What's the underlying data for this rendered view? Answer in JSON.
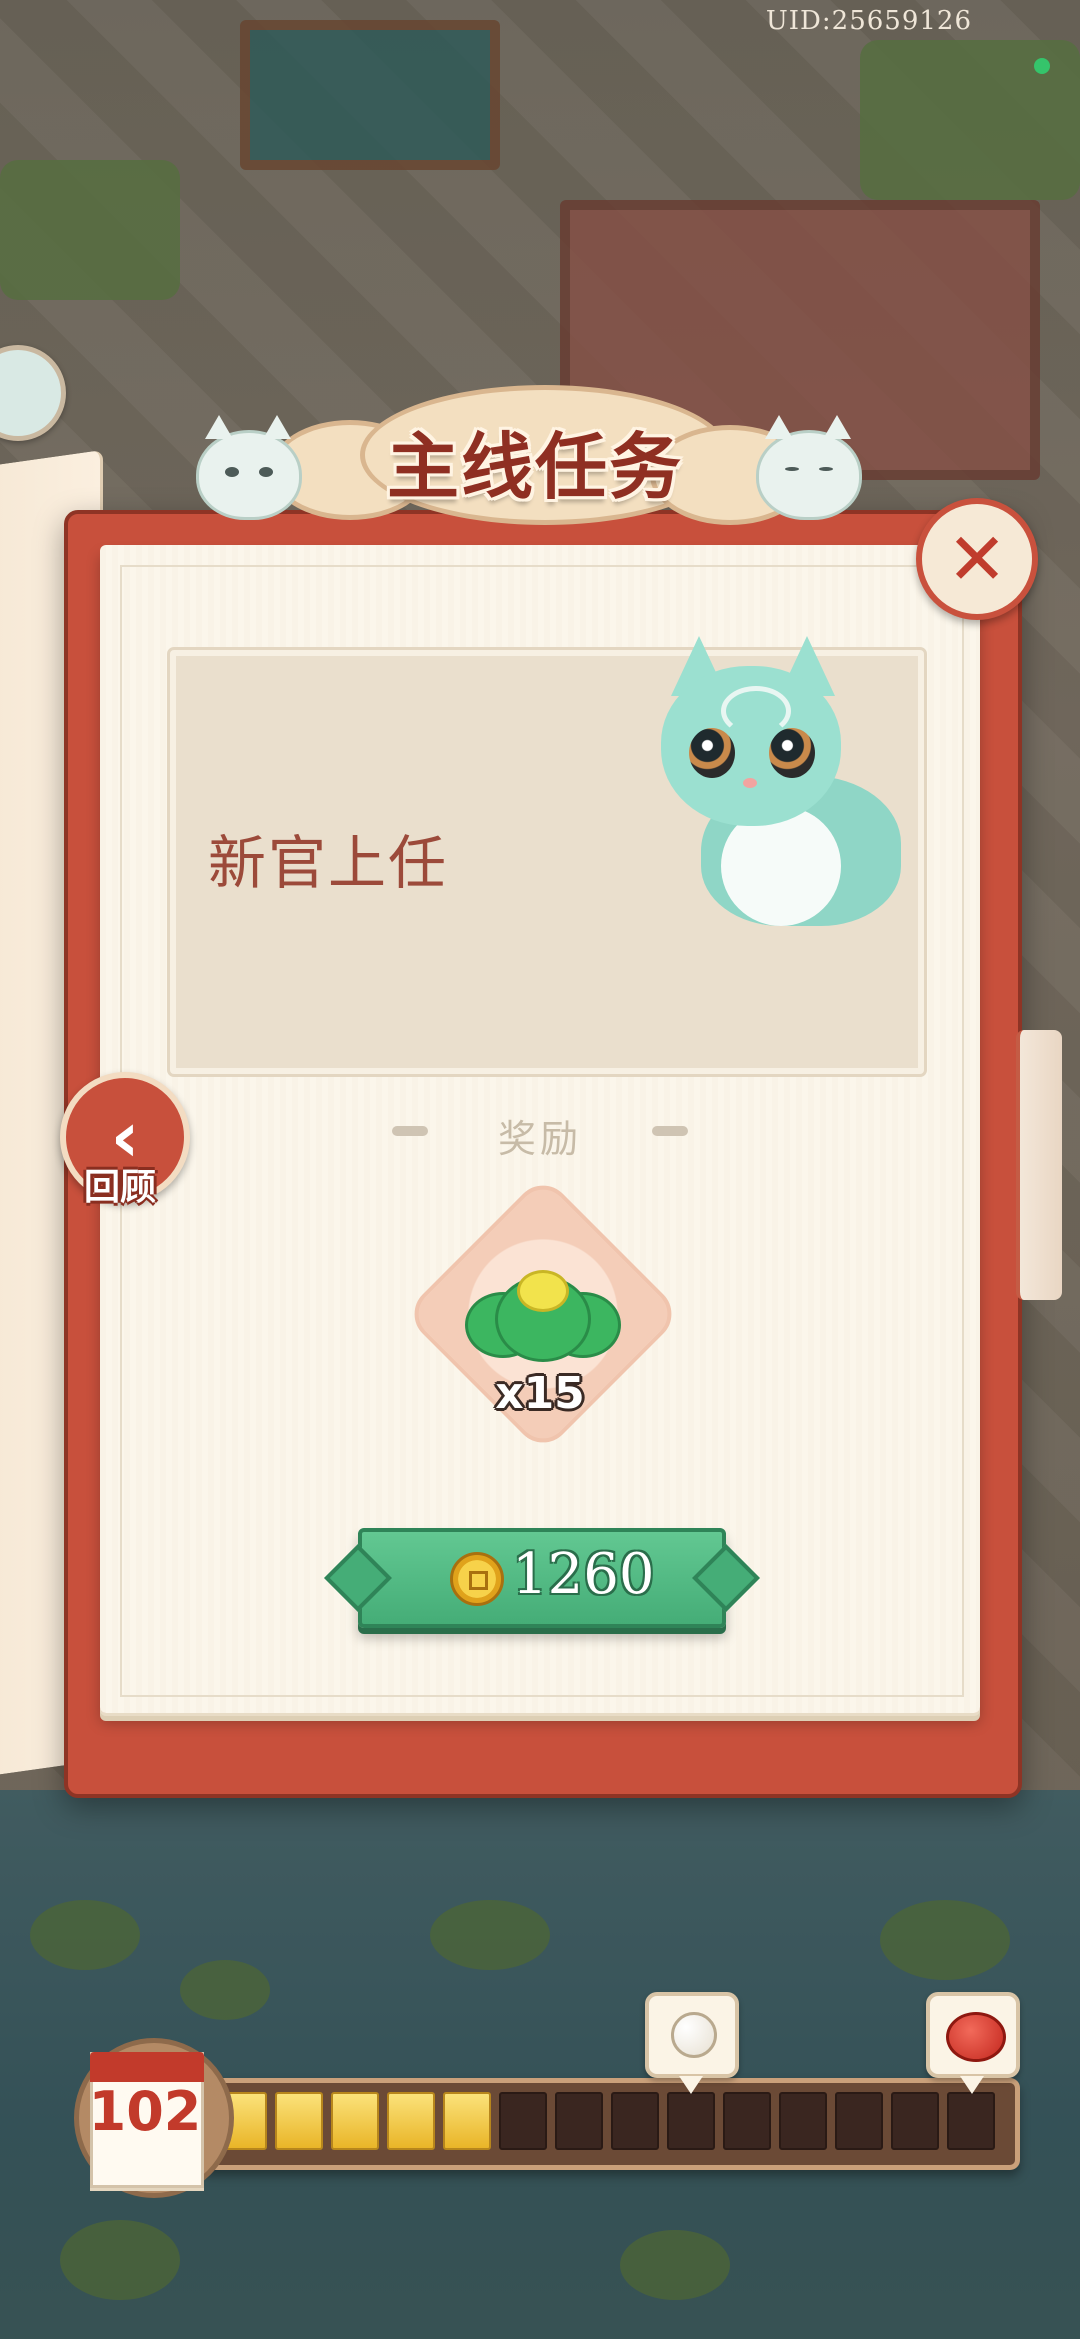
{
  "header": {
    "uid_text": "UID:25659126"
  },
  "dialog": {
    "title": "主线任务",
    "task_name": "新官上任",
    "reward_label": "奖励",
    "reward_item": {
      "icon": "jade-cloud-icon",
      "count": "x15"
    },
    "cost": {
      "icon": "coin-icon",
      "value": "1260"
    },
    "review_label": "回顾",
    "close_icon": "close-icon"
  },
  "progress": {
    "day": "102",
    "segments_total": 14,
    "segments_filled": 5,
    "milestones": [
      {
        "icon": "cotton-icon",
        "at_segment": 9
      },
      {
        "icon": "red-seal-icon",
        "at_segment": 14
      }
    ]
  },
  "colors": {
    "frame_red": "#c8503c",
    "title_red": "#8f2f22",
    "cost_green": "#45ad77",
    "progress_gold": "#e9b528"
  }
}
